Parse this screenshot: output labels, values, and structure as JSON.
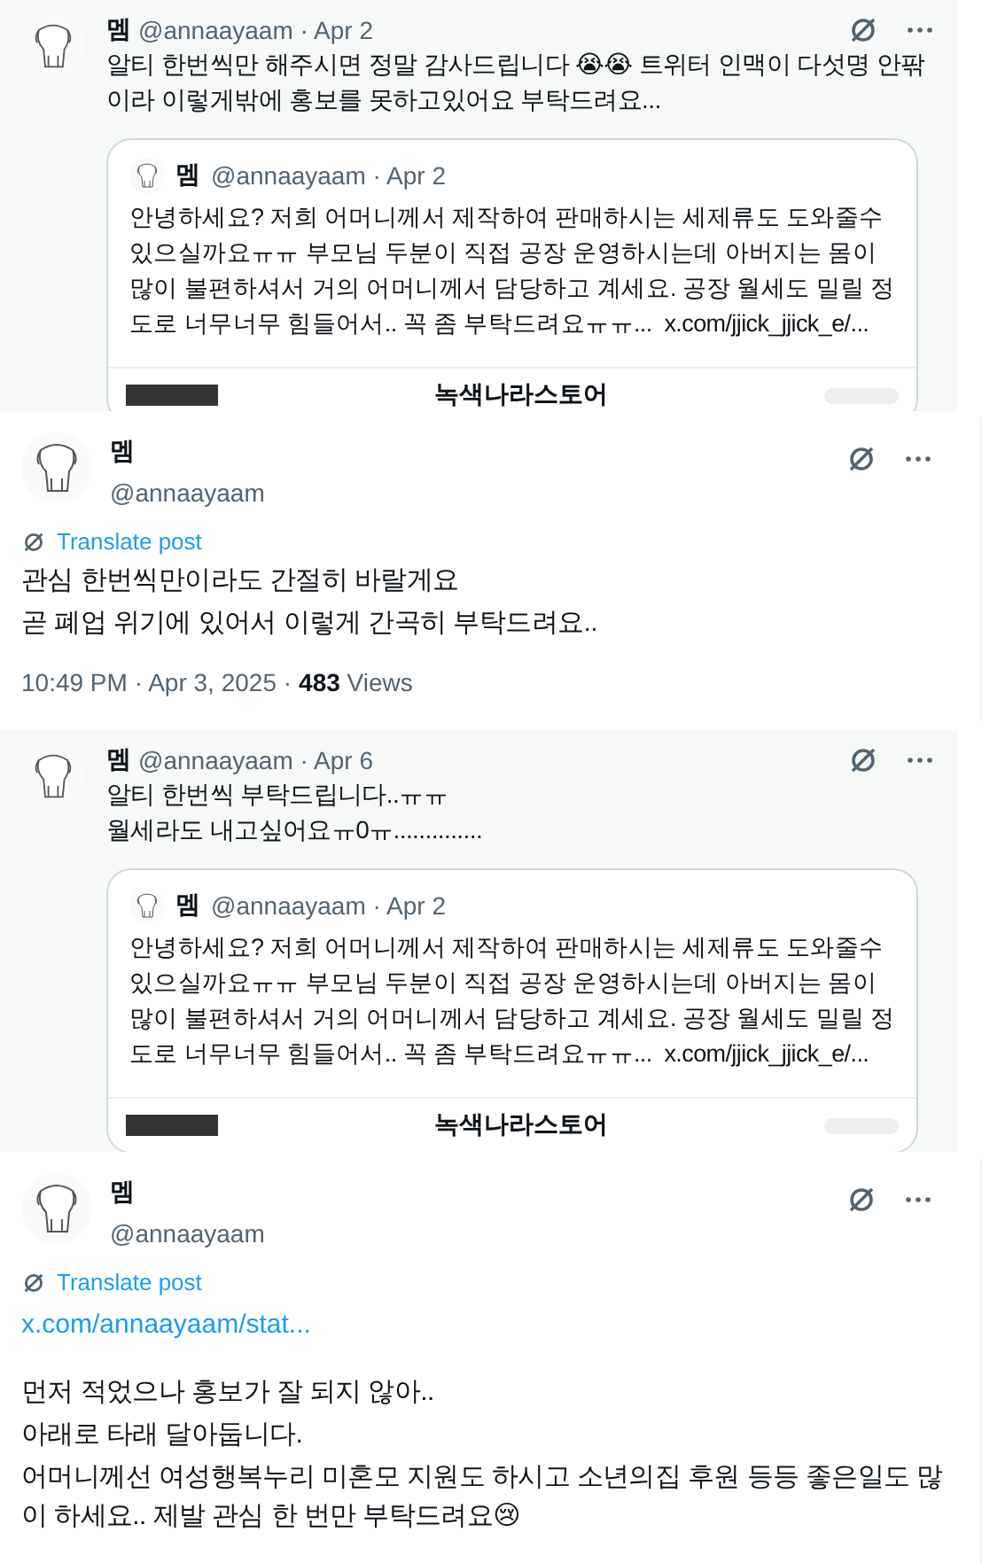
{
  "panels": [
    {
      "kind": "reply",
      "name": "멤",
      "meta": "@annaayaam · Apr 2",
      "lines": [
        "알티 한번씩만 해주시면 정말 감사드립니다 😭😭 트위터 인맥이 다섯명 안팎이라 이렇게밖에 홍보를 못하고있어요 부탁드려요..."
      ],
      "quote": {
        "name": "멤",
        "meta": "@annaayaam · Apr 2",
        "text": "안녕하세요? 저희 어머니께서 제작하여 판매하시는 세제류도 도와줄수 있으실까요ㅠㅠ 부모님 두분이 직접 공장 운영하시는데 아버지는 몸이 많이 불편하셔서 거의 어머니께서 담당하고 계세요. 공장 월세도 밀릴 정도로 너무너무 힘들어서.. 꼭 좀 부탁드려요ㅠㅠ...",
        "link": "x.com/jjick_jjick_e/...",
        "preview_title": "녹색나라스토어"
      }
    },
    {
      "kind": "main",
      "name": "멤",
      "handle": "@annaayaam",
      "translate": "Translate post",
      "lines": [
        "관심 한번씩만이라도 간절히 바랄게요",
        "곧 폐업 위기에 있어서 이렇게 간곡히 부탁드려요.."
      ],
      "time": "10:49 PM · Apr 3, 2025 ·",
      "views": "**483** Views"
    },
    {
      "kind": "reply",
      "name": "멤",
      "meta": "@annaayaam · Apr 6",
      "lines": [
        "알티 한번씩 부탁드립니다..ㅠㅠ",
        "월세라도 내고싶어요ㅠ0ㅠ.............."
      ],
      "quote": {
        "name": "멤",
        "meta": "@annaayaam · Apr 2",
        "text": "안녕하세요? 저희 어머니께서 제작하여 판매하시는 세제류도 도와줄수 있으실까요ㅠㅠ 부모님 두분이 직접 공장 운영하시는데 아버지는 몸이 많이 불편하셔서 거의 어머니께서 담당하고 계세요. 공장 월세도 밀릴 정도로 너무너무 힘들어서.. 꼭 좀 부탁드려요ㅠㅠ...",
        "link": "x.com/jjick_jjick_e/...",
        "preview_title": "녹색나라스토어"
      }
    },
    {
      "kind": "main",
      "name": "멤",
      "handle": "@annaayaam",
      "translate": "Translate post",
      "link": "x.com/annaayaam/stat...",
      "lines": [
        "먼저 적었으나 홍보가 잘 되지 않아..",
        "아래로 타래 달아둡니다.",
        "어머니께선 여성행복누리 미혼모 지원도 하시고 소년의집 후원 등등 좋은일도 많이 하세요.. 제발 관심 한 번만 부탁드려요😢"
      ]
    }
  ]
}
